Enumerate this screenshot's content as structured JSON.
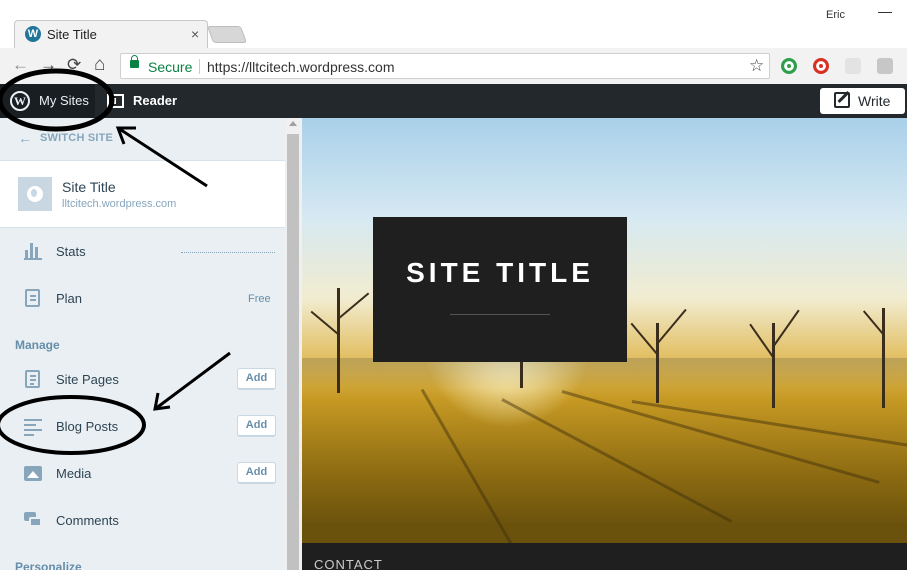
{
  "browser": {
    "tab_title": "Site Title",
    "tab_close": "×",
    "user_name": "Eric",
    "minimize": "—",
    "nav": {
      "back": "←",
      "forward": "→",
      "reload": "⟳",
      "home": "⌂"
    },
    "secure_label": "Secure",
    "url": "https://lltcitech.wordpress.com",
    "bookmark_star": "☆"
  },
  "masterbar": {
    "my_sites_label": "My Sites",
    "reader_label": "Reader",
    "write_label": "Write"
  },
  "sidebar": {
    "switch_site_label": "SWITCH SITE",
    "switch_arrow": "←",
    "site": {
      "name": "Site Title",
      "url": "lltcitech.wordpress.com"
    },
    "items": [
      {
        "label": "Stats"
      },
      {
        "label": "Plan",
        "badge": "Free"
      }
    ],
    "manage_heading": "Manage",
    "manage_items": [
      {
        "label": "Site Pages",
        "button": "Add"
      },
      {
        "label": "Blog Posts",
        "button": "Add"
      },
      {
        "label": "Media",
        "button": "Add"
      },
      {
        "label": "Comments"
      }
    ],
    "personalize_heading": "Personalize"
  },
  "preview": {
    "site_title": "SITE TITLE",
    "footer_link": "CONTACT"
  },
  "colors": {
    "masterbar_bg": "#23282d",
    "sidebar_bg": "#e9eff3",
    "annotation": "#000000",
    "secure_green": "#0b8043"
  }
}
